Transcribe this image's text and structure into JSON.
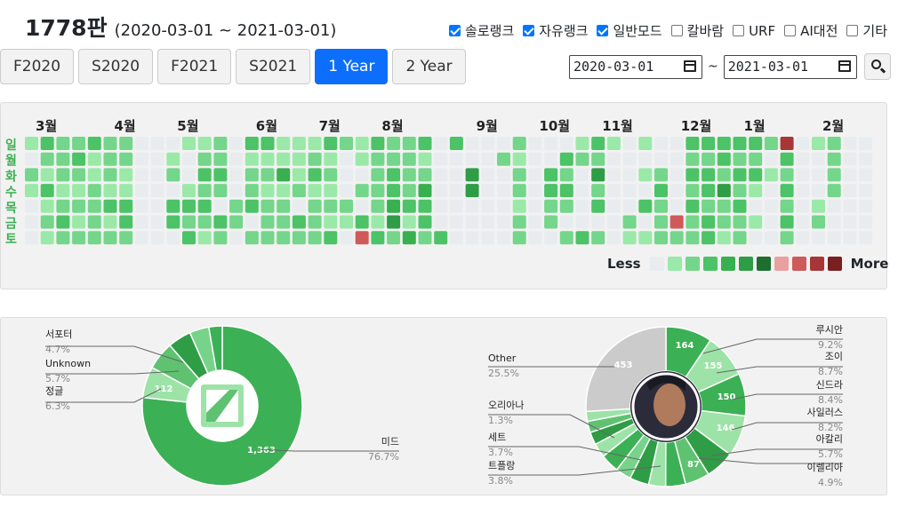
{
  "header": {
    "title": "1778판",
    "range": "(2020-03-01 ~ 2021-03-01)"
  },
  "modes": [
    {
      "label": "솔로랭크",
      "checked": true
    },
    {
      "label": "자유랭크",
      "checked": true
    },
    {
      "label": "일반모드",
      "checked": true
    },
    {
      "label": "칼바람",
      "checked": false
    },
    {
      "label": "URF",
      "checked": false
    },
    {
      "label": "AI대전",
      "checked": false
    },
    {
      "label": "기타",
      "checked": false
    }
  ],
  "seasons": [
    {
      "label": "F2020",
      "active": false
    },
    {
      "label": "S2020",
      "active": false
    },
    {
      "label": "F2021",
      "active": false
    },
    {
      "label": "S2021",
      "active": false
    },
    {
      "label": "1 Year",
      "active": true
    },
    {
      "label": "2 Year",
      "active": false
    }
  ],
  "date_filter": {
    "from": "2020-03-01",
    "to": "2021-03-01",
    "separator": "~"
  },
  "heatmap": {
    "months": [
      "3월",
      "4월",
      "5월",
      "6월",
      "7월",
      "8월",
      "9월",
      "10월",
      "11월",
      "12월",
      "1월",
      "2월"
    ],
    "month_cols": [
      0,
      5,
      9,
      14,
      18,
      22,
      28,
      32,
      36,
      41,
      45,
      50
    ],
    "weekdays": [
      "일",
      "월",
      "화",
      "수",
      "목",
      "금",
      "토"
    ],
    "legend_less": "Less",
    "legend_more": "More",
    "levels": [
      "#e9ecef",
      "#9be9a8",
      "#74d68a",
      "#4cc366",
      "#38b04f",
      "#2e9d45",
      "#1f6e30",
      "#e8a0a0",
      "#cf5a5a",
      "#a93636",
      "#7a1f1f"
    ],
    "weeks": [
      "1021000",
      "3213121",
      "2221232",
      "2321212",
      "3112222",
      "2221312",
      "2211332",
      "0000000",
      "0000000",
      "0120330",
      "1001323",
      "1232321",
      "2232032",
      "0000220",
      "3122302",
      "3121222",
      "1141222",
      "1112032",
      "1231222",
      "3121213",
      "2000210",
      "1102038",
      "3222213",
      "2233452",
      "2222314",
      "3124332",
      "0000003",
      "3000000",
      "0055000",
      "0000000",
      "0200000",
      "2122122",
      "0000000",
      "0033220",
      "0323202",
      "1200003",
      "3252302",
      "1000000",
      "0000021",
      "1010301",
      "0023222",
      "0000082",
      "3232322",
      "3233233",
      "3325221",
      "3232322",
      "3231010",
      "2010000",
      "9323232",
      "0000000",
      "1000120",
      "2222000",
      "0000000",
      "0000000"
    ]
  },
  "charts": {
    "left": {
      "slices": [
        {
          "label": "미드",
          "pct": "76.7%",
          "value": 1363,
          "color": "#3cb054"
        },
        {
          "label": "정글",
          "pct": "6.3%",
          "value": 112,
          "color": "#9de3a8"
        },
        {
          "label": "Unknown",
          "pct": "5.7%",
          "value": 101,
          "color": "#5fc271"
        },
        {
          "label": "서포터",
          "pct": "4.7%",
          "value": 84,
          "color": "#2e9d45"
        },
        {
          "label": "",
          "pct": "",
          "value": 70,
          "color": "#76d389"
        },
        {
          "label": "",
          "pct": "",
          "value": 48,
          "color": "#3cb054"
        }
      ],
      "inner_labels": [
        "1,363",
        "112"
      ]
    },
    "right": {
      "slices": [
        {
          "label": "루시안",
          "pct": "9.2%",
          "value": 164,
          "color": "#3cb054"
        },
        {
          "label": "조이",
          "pct": "8.7%",
          "value": 155,
          "color": "#9de3a8"
        },
        {
          "label": "신드라",
          "pct": "8.4%",
          "value": 150,
          "color": "#3cb054"
        },
        {
          "label": "사일러스",
          "pct": "8.2%",
          "value": 146,
          "color": "#9de3a8"
        },
        {
          "label": "아칼리",
          "pct": "5.7%",
          "value": 102,
          "color": "#2e9d45"
        },
        {
          "label": "이렐리아",
          "pct": "4.9%",
          "value": 87,
          "color": "#5fc271"
        },
        {
          "label": "",
          "pct": "",
          "value": 70,
          "color": "#3cb054"
        },
        {
          "label": "",
          "pct": "",
          "value": 60,
          "color": "#9de3a8"
        },
        {
          "label": "트플랑",
          "pct": "3.8%",
          "value": 68,
          "color": "#2e9d45"
        },
        {
          "label": "",
          "pct": "",
          "value": 55,
          "color": "#76d389"
        },
        {
          "label": "세트",
          "pct": "3.7%",
          "value": 66,
          "color": "#3cb054"
        },
        {
          "label": "",
          "pct": "",
          "value": 50,
          "color": "#9de3a8"
        },
        {
          "label": "",
          "pct": "",
          "value": 45,
          "color": "#2e9d45"
        },
        {
          "label": "오리아나",
          "pct": "1.3%",
          "value": 40,
          "color": "#5fc271"
        },
        {
          "label": "",
          "pct": "",
          "value": 35,
          "color": "#9de3a8"
        },
        {
          "label": "Other",
          "pct": "25.5%",
          "value": 453,
          "color": "#cbcbcb"
        }
      ],
      "inner_labels": [
        "164",
        "155",
        "150",
        "146",
        "87",
        "453"
      ]
    }
  }
}
